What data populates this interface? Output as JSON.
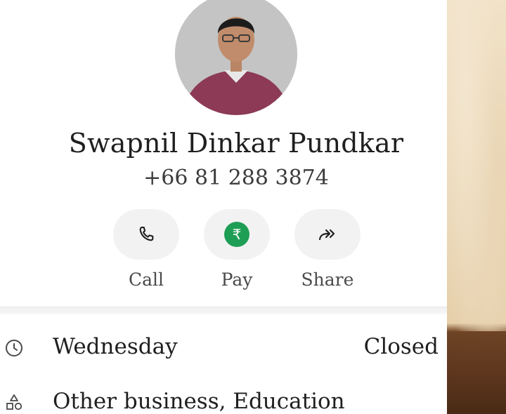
{
  "profile": {
    "name": "Swapnil Dinkar Pundkar",
    "phone": "+66 81 288 3874"
  },
  "actions": {
    "call": {
      "label": "Call",
      "icon": "phone-icon"
    },
    "pay": {
      "label": "Pay",
      "icon": "rupee-icon",
      "symbol": "₹",
      "accent": "#1e9e55"
    },
    "share": {
      "label": "Share",
      "icon": "share-arrow-icon"
    }
  },
  "details": {
    "hours": {
      "icon": "clock-icon",
      "day": "Wednesday",
      "status": "Closed"
    },
    "category": {
      "icon": "category-shapes-icon",
      "text": "Other business, Education"
    }
  }
}
